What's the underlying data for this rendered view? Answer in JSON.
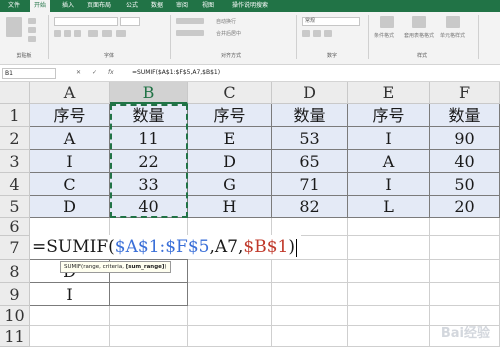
{
  "ribbon": {
    "tabs": [
      "文件",
      "开始",
      "插入",
      "页面布局",
      "公式",
      "数据",
      "审阅",
      "视图",
      "操作说明搜索"
    ],
    "groups": [
      "剪贴板",
      "字体",
      "对齐方式",
      "数字",
      "样式"
    ],
    "commands": {
      "wrap": "自动换行",
      "merge": "合并后居中",
      "number_format": "常规",
      "conditional_format": "条件格式",
      "table_format": "套用表格格式",
      "cell_styles": "单元格样式"
    },
    "accent": "#217346"
  },
  "formula_bar": {
    "name_box": "B1",
    "cancel_glyph": "✕",
    "enter_glyph": "✓",
    "fx_glyph": "fx",
    "formula": "=SUMIF($A$1:$F$5,A7,$B$1)"
  },
  "grid": {
    "columns": [
      "A",
      "B",
      "C",
      "D",
      "E",
      "F"
    ],
    "rows": [
      "1",
      "2",
      "3",
      "4",
      "5",
      "6",
      "7",
      "8",
      "9",
      "10",
      "11"
    ],
    "table": [
      [
        "序号",
        "数量",
        "序号",
        "数量",
        "序号",
        "数量"
      ],
      [
        "A",
        "11",
        "E",
        "53",
        "I",
        "90"
      ],
      [
        "I",
        "22",
        "D",
        "65",
        "A",
        "40"
      ],
      [
        "C",
        "33",
        "G",
        "71",
        "I",
        "50"
      ],
      [
        "D",
        "40",
        "H",
        "82",
        "L",
        "20"
      ]
    ],
    "lookup_a8": "D",
    "lookup_a9": "I",
    "table_fill": "#e4eaf6"
  },
  "editing": {
    "prefix": "=SUMIF(",
    "range1": "$A$1:$F$5",
    "sep1": ",A7,",
    "range2": "$B$1",
    "suffix": ")",
    "range1_color": "#3a6fd8",
    "range2_color": "#c0392b",
    "tooltip_main": "SUMIF(range, criteria, ",
    "tooltip_bold": "[sum_range]",
    "tooltip_end": ")"
  },
  "watermark": "Bai经验"
}
